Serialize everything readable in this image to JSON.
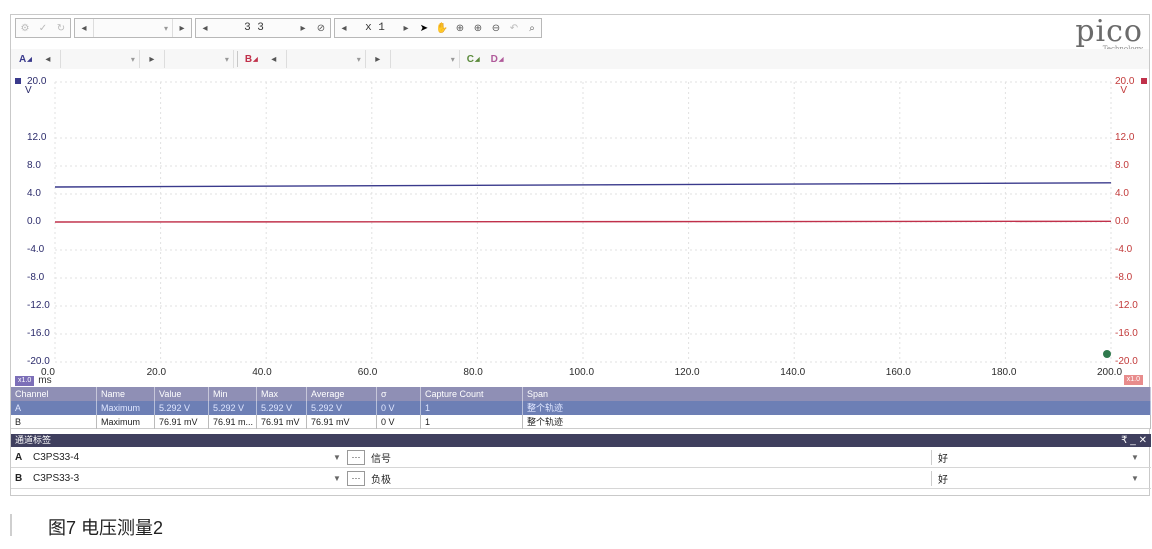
{
  "toolbar": {
    "timebase_value": "3 3",
    "zoom_value": "x 1"
  },
  "channel_bar": {
    "a_label": "A",
    "b_label": "B",
    "c_label": "C",
    "d_label": "D"
  },
  "logo": {
    "word": "pico",
    "sub": "Technology"
  },
  "plot": {
    "y_left_unit": "V",
    "y_right_unit": "V",
    "x_unit": "ms",
    "zoom_left": "x1.0",
    "zoom_right": "x1.0",
    "colors": {
      "channel_a": "#3a3a8c",
      "channel_b": "#c0304a",
      "grid": "#e2e2e2",
      "right_axis": "#c23a3a"
    }
  },
  "chart_data": {
    "type": "line",
    "xlabel": "ms",
    "ylabel": "V",
    "xlim": [
      0,
      200
    ],
    "ylim": [
      -20,
      20
    ],
    "x_ticks": [
      "0.0",
      "20.0",
      "40.0",
      "60.0",
      "80.0",
      "100.0",
      "120.0",
      "140.0",
      "160.0",
      "180.0",
      "200.0"
    ],
    "y_ticks_left": [
      "20.0",
      "12.0",
      "8.0",
      "4.0",
      "0.0",
      "-4.0",
      "-8.0",
      "-12.0",
      "-16.0",
      "-20.0"
    ],
    "y_ticks_right": [
      "20.0",
      "12.0",
      "8.0",
      "4.0",
      "0.0",
      "-4.0",
      "-8.0",
      "-12.0",
      "-16.0",
      "-20.0"
    ],
    "grid": true,
    "series": [
      {
        "name": "A",
        "x": [
          0,
          200
        ],
        "y": [
          5.0,
          5.6
        ]
      },
      {
        "name": "B",
        "x": [
          0,
          200
        ],
        "y": [
          0.0,
          0.1
        ]
      }
    ]
  },
  "measurements": {
    "headers": [
      "Channel",
      "Name",
      "Value",
      "Min",
      "Max",
      "Average",
      "σ",
      "Capture Count",
      "Span"
    ],
    "rows": [
      [
        "A",
        "Maximum",
        "5.292 V",
        "5.292 V",
        "5.292 V",
        "5.292 V",
        "0 V",
        "1",
        "整个轨迹"
      ],
      [
        "B",
        "Maximum",
        "76.91 mV",
        "76.91 m...",
        "76.91 mV",
        "76.91 mV",
        "0 V",
        "1",
        "整个轨迹"
      ]
    ]
  },
  "channel_labels": {
    "title": "通道标签",
    "controls": "₹ _ ✕",
    "rows": [
      {
        "channel": "A",
        "name": "C3PS33-4",
        "description": "信号",
        "state": "好"
      },
      {
        "channel": "B",
        "name": "C3PS33-3",
        "description": "负极",
        "state": "好"
      }
    ]
  },
  "caption": "图7   电压测量2"
}
